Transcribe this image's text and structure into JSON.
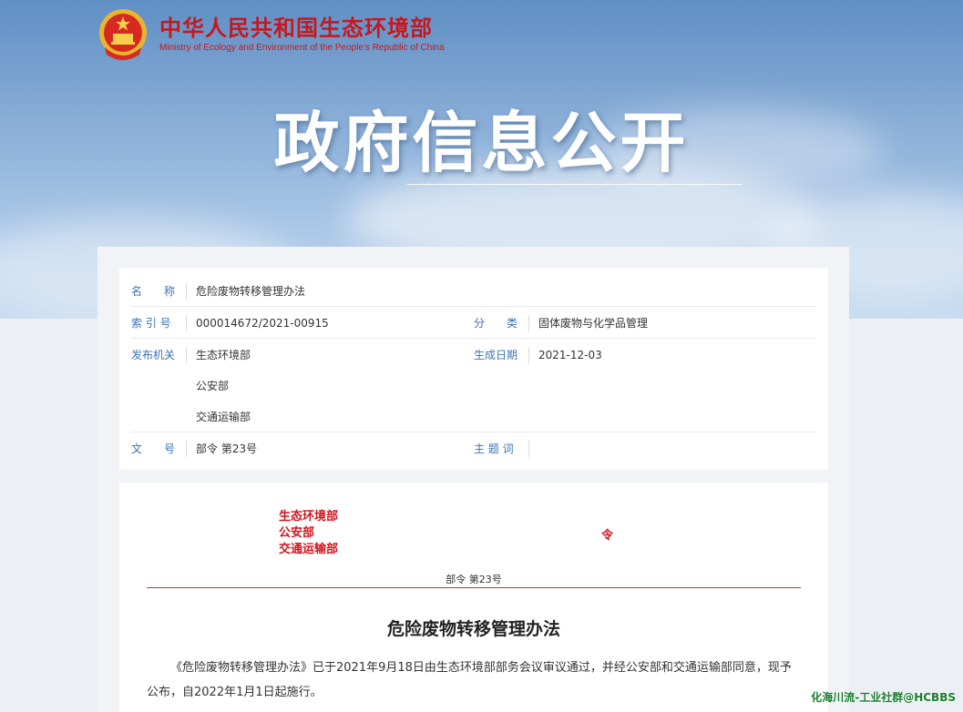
{
  "header": {
    "org_cn": "中华人民共和国生态环境部",
    "org_en": "Ministry of Ecology and Environment of the People's Republic of China",
    "banner_title": "政府信息公开"
  },
  "meta": {
    "name_label": "名　　称",
    "name_value": "危险废物转移管理办法",
    "index_label": "索 引 号",
    "index_value": "000014672/2021-00915",
    "category_label": "分　　类",
    "category_value": "固体废物与化学品管理",
    "issuer_label": "发布机关",
    "issuer_values": [
      "生态环境部",
      "公安部",
      "交通运输部"
    ],
    "date_label": "生成日期",
    "date_value": "2021-12-03",
    "docno_label": "文　　号",
    "docno_value": "部令 第23号",
    "subject_label": "主 题 词",
    "subject_value": ""
  },
  "document": {
    "issuers": [
      "生态环境部",
      "公安部",
      "交通运输部"
    ],
    "order_char": "令",
    "doc_number": "部令 第23号",
    "title": "危险废物转移管理办法",
    "body": "《危险废物转移管理办法》已于2021年9月18日由生态环境部部务会议审议通过，并经公安部和交通运输部同意，现予公布，自2022年1月1日起施行。"
  },
  "watermark": "化海川流-工业社群@HCBBS",
  "colors": {
    "accent_red": "#c8171c",
    "label_blue": "#3b73b5"
  }
}
